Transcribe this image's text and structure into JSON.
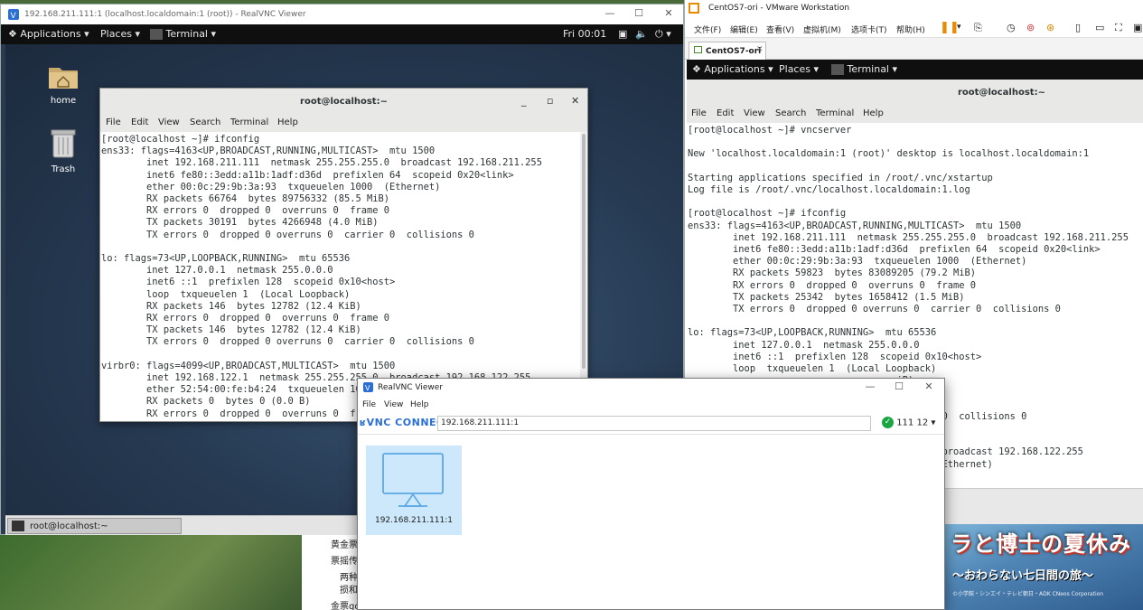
{
  "vnc": {
    "title": "192.168.211.111:1 (localhost.localdomain:1 (root)) - RealVNC Viewer",
    "gnome": {
      "applications": "Applications",
      "places": "Places",
      "terminal": "Terminal",
      "clock": "Fri 00:01"
    },
    "desktop_icons": [
      {
        "label": "home"
      },
      {
        "label": "Trash"
      }
    ],
    "taskbar_item": "root@localhost:~"
  },
  "term_left": {
    "title": "root@localhost:~",
    "menu": [
      "File",
      "Edit",
      "View",
      "Search",
      "Terminal",
      "Help"
    ],
    "text": "[root@localhost ~]# ifconfig\nens33: flags=4163<UP,BROADCAST,RUNNING,MULTICAST>  mtu 1500\n        inet 192.168.211.111  netmask 255.255.255.0  broadcast 192.168.211.255\n        inet6 fe80::3edd:a11b:1adf:d36d  prefixlen 64  scopeid 0x20<link>\n        ether 00:0c:29:9b:3a:93  txqueuelen 1000  (Ethernet)\n        RX packets 66764  bytes 89756332 (85.5 MiB)\n        RX errors 0  dropped 0  overruns 0  frame 0\n        TX packets 30191  bytes 4266948 (4.0 MiB)\n        TX errors 0  dropped 0 overruns 0  carrier 0  collisions 0\n\nlo: flags=73<UP,LOOPBACK,RUNNING>  mtu 65536\n        inet 127.0.0.1  netmask 255.0.0.0\n        inet6 ::1  prefixlen 128  scopeid 0x10<host>\n        loop  txqueuelen 1  (Local Loopback)\n        RX packets 146  bytes 12782 (12.4 KiB)\n        RX errors 0  dropped 0  overruns 0  frame 0\n        TX packets 146  bytes 12782 (12.4 KiB)\n        TX errors 0  dropped 0 overruns 0  carrier 0  collisions 0\n\nvirbr0: flags=4099<UP,BROADCAST,MULTICAST>  mtu 1500\n        inet 192.168.122.1  netmask 255.255.255.0  broadcast 192.168.122.255\n        ether 52:54:00:fe:b4:24  txqueuelen 1000  (Ethernet)\n        RX packets 0  bytes 0 (0.0 B)\n        RX errors 0  dropped 0  overruns 0  frame 0"
  },
  "vmware": {
    "title": "CentOS7-ori - VMware Workstation",
    "menu": [
      "文件(F)",
      "编辑(E)",
      "查看(V)",
      "虚拟机(M)",
      "选项卡(T)",
      "帮助(H)"
    ],
    "tab": "CentOS7-ori",
    "gnome": {
      "applications": "Applications",
      "places": "Places",
      "terminal": "Terminal"
    }
  },
  "term_right": {
    "title": "root@localhost:~",
    "menu": [
      "File",
      "Edit",
      "View",
      "Search",
      "Terminal",
      "Help"
    ],
    "text": "[root@localhost ~]# vncserver\n\nNew 'localhost.localdomain:1 (root)' desktop is localhost.localdomain:1\n\nStarting applications specified in /root/.vnc/xstartup\nLog file is /root/.vnc/localhost.localdomain:1.log\n\n[root@localhost ~]# ifconfig\nens33: flags=4163<UP,BROADCAST,RUNNING,MULTICAST>  mtu 1500\n        inet 192.168.211.111  netmask 255.255.255.0  broadcast 192.168.211.255\n        inet6 fe80::3edd:a11b:1adf:d36d  prefixlen 64  scopeid 0x20<link>\n        ether 00:0c:29:9b:3a:93  txqueuelen 1000  (Ethernet)\n        RX packets 59823  bytes 83089205 (79.2 MiB)\n        RX errors 0  dropped 0  overruns 0  frame 0\n        TX packets 25342  bytes 1658412 (1.5 MiB)\n        TX errors 0  dropped 0 overruns 0  carrier 0  collisions 0\n\nlo: flags=73<UP,LOOPBACK,RUNNING>  mtu 65536\n        inet 127.0.0.1  netmask 255.0.0.0\n        inet6 ::1  prefixlen 128  scopeid 0x10<host>\n        loop  txqueuelen 1  (Local Loopback)\n                                     iB)\n                                     frame 0\n                                     iB)\n                                     carrier 0  collisions 0\n\n                                     mtu 1500\n                                     .255.0  broadcast 192.168.122.255\n                                      1000  (Ethernet)"
  },
  "realvnc": {
    "title": "RealVNC Viewer",
    "menu": [
      "File",
      "View",
      "Help"
    ],
    "logo": "ʁVNC CONNECT",
    "address": "192.168.211.111:1",
    "sign_in": "111 12",
    "thumb_label": "192.168.211.111:1"
  },
  "background": {
    "banner": {
      "line1": "ラと博士の夏休み",
      "line2": "～おわらない七日間の旅～",
      "line3": "©小学館・シンエイ・テレビ朝日・ADK  CNeos Corporation"
    },
    "side_text": [
      "黄金票",
      "票摇传",
      "两种",
      "损和",
      "金票go"
    ]
  }
}
